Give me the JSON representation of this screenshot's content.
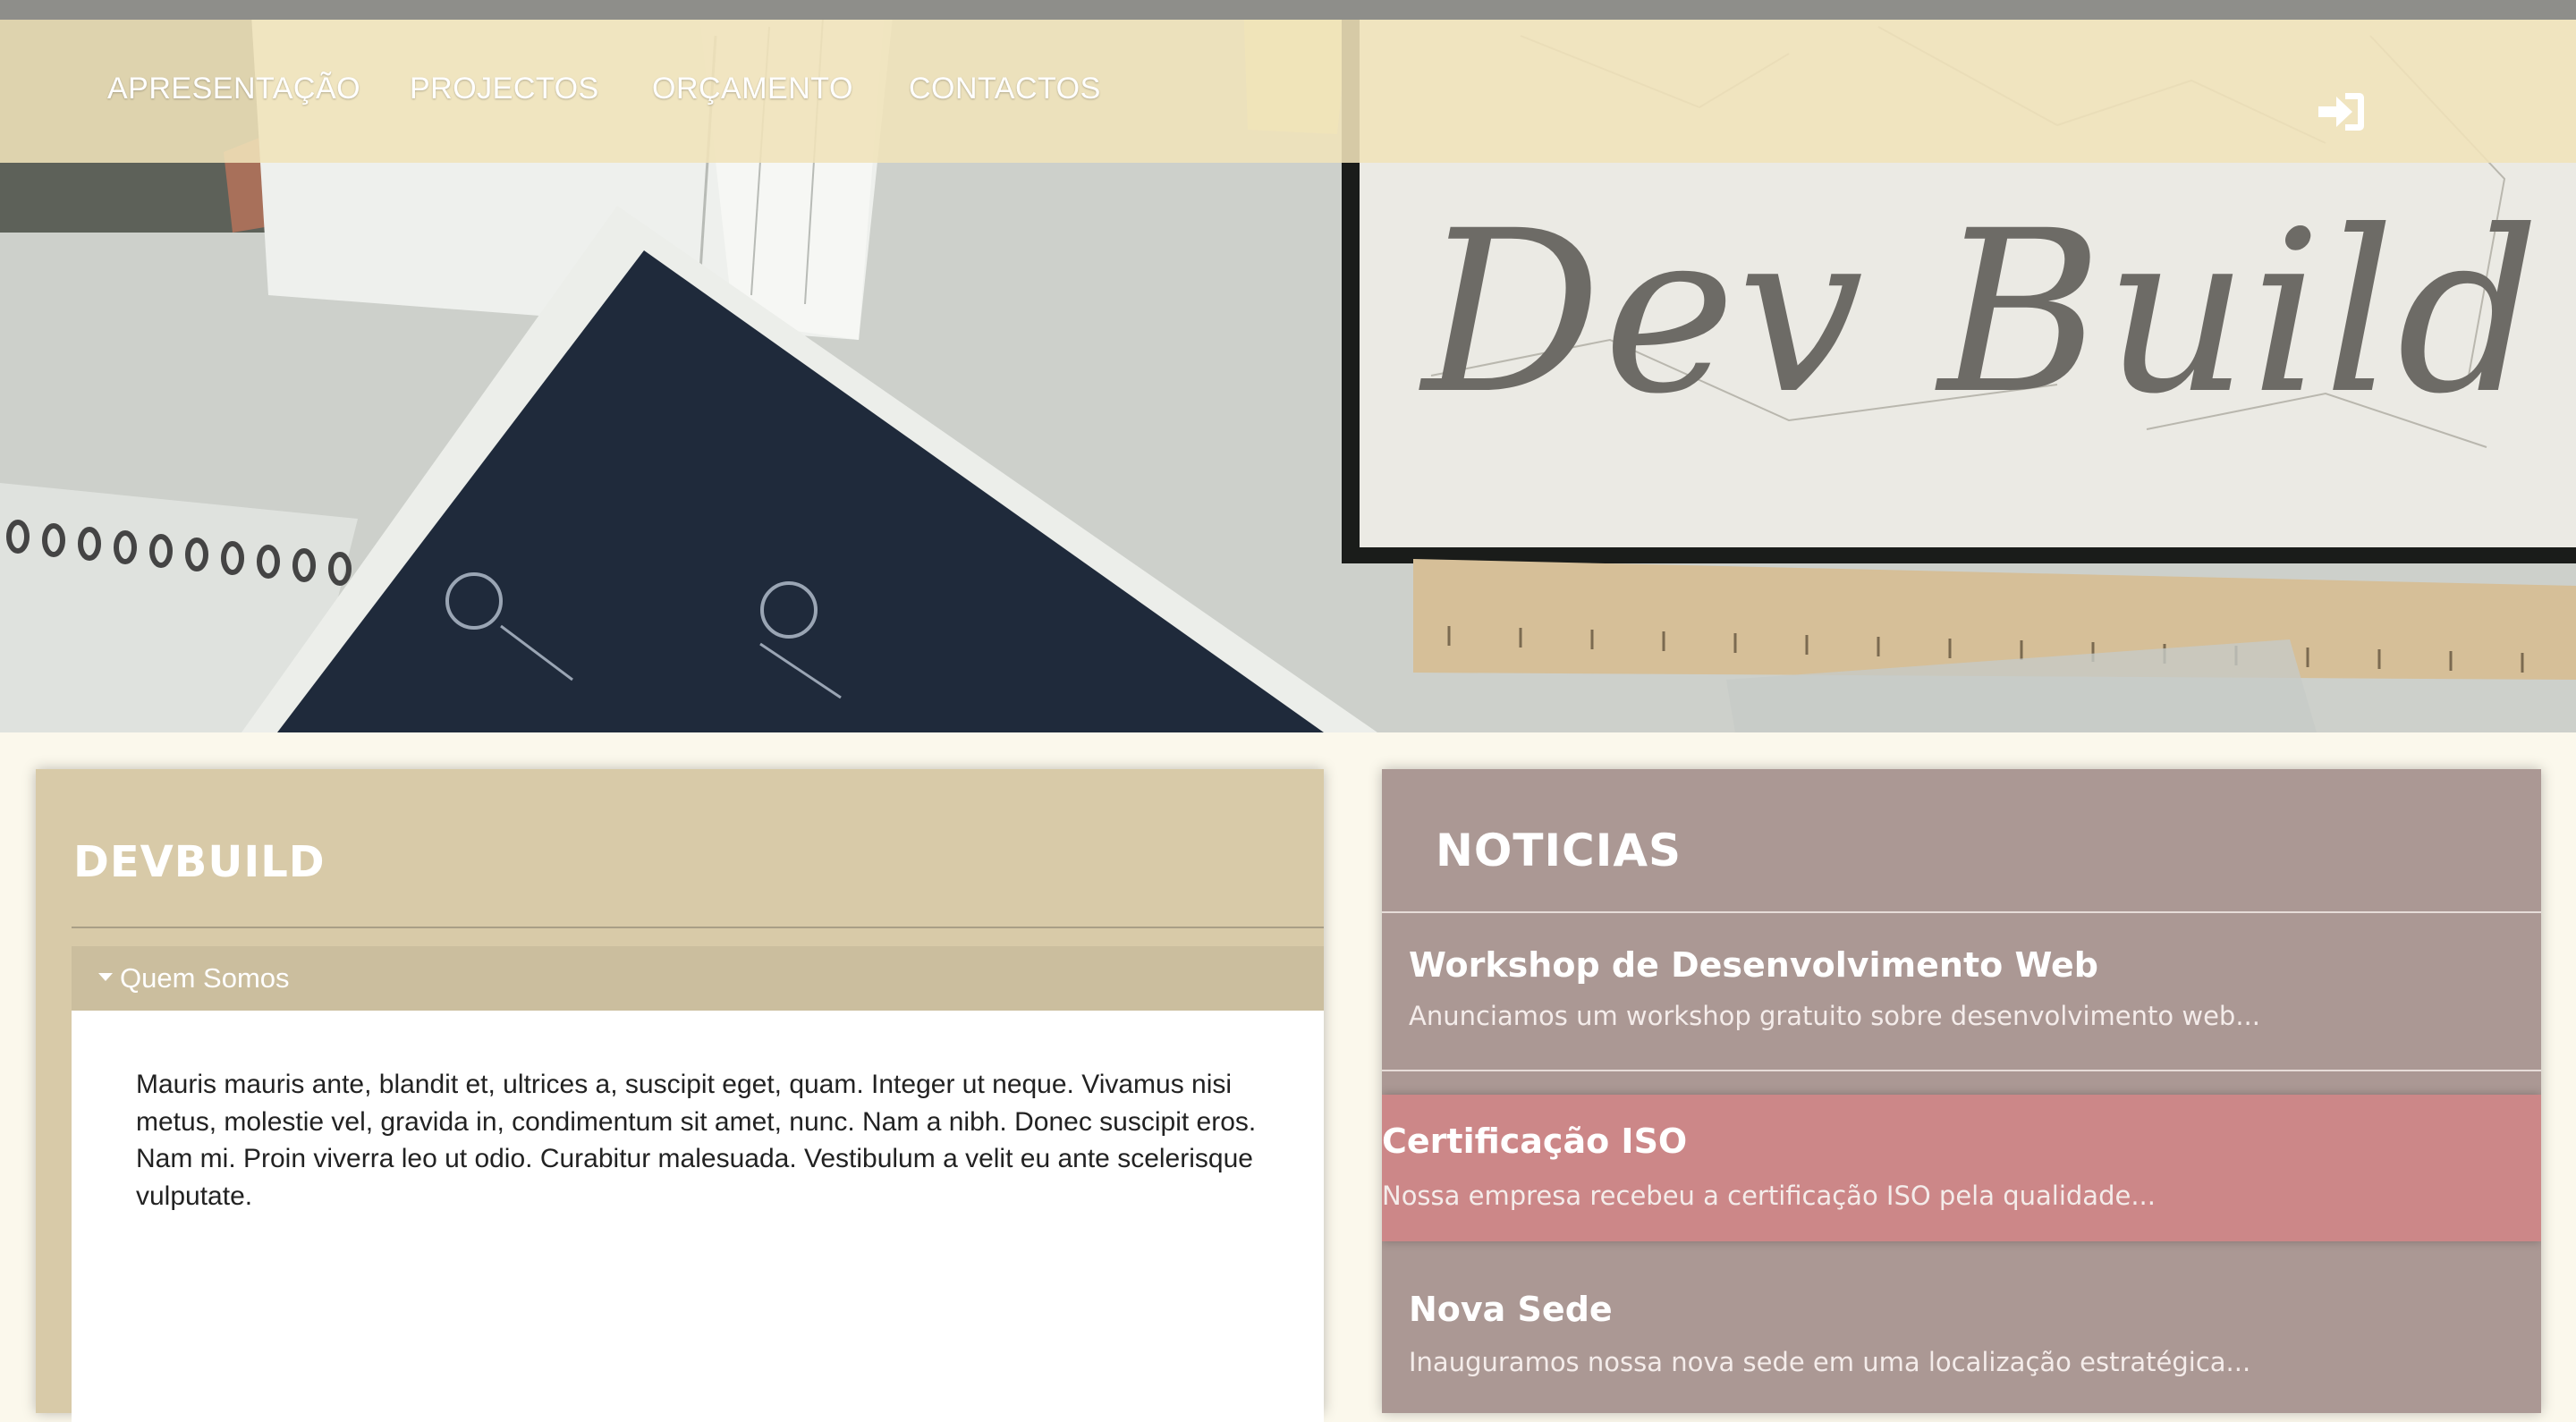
{
  "nav": {
    "items": [
      {
        "label": "APRESENTAÇÃO"
      },
      {
        "label": "PROJECTOS"
      },
      {
        "label": "ORÇAMENTO"
      },
      {
        "label": "CONTACTOS"
      }
    ],
    "login_icon": "sign-in-icon"
  },
  "hero": {
    "brand": "Dev Build"
  },
  "left_panel": {
    "title": "DEVBUILD",
    "accordion": {
      "title": "Quem Somos",
      "expanded": true,
      "body": "Mauris mauris ante, blandit et, ultrices a, suscipit eget, quam. Integer ut neque. Vivamus nisi metus, molestie vel, gravida in, condimentum sit amet, nunc. Nam a nibh. Donec suscipit eros. Nam mi. Proin viverra leo ut odio. Curabitur malesuada. Vestibulum a velit eu ante scelerisque vulputate."
    }
  },
  "right_panel": {
    "title": "NOTICIAS",
    "news": [
      {
        "title": "Workshop de Desenvolvimento Web",
        "desc": "Anunciamos um workshop gratuito sobre desenvolvimento web..."
      },
      {
        "title": "Certificação ISO",
        "desc": "Nossa empresa recebeu a certificação ISO pela qualidade..."
      },
      {
        "title": "Nova Sede",
        "desc": "Inauguramos nossa nova sede em uma localização estratégica..."
      }
    ]
  },
  "colors": {
    "page_bg": "#fbf8ec",
    "navbar": "#f0e2ba",
    "left_panel": "#d8caa8",
    "accordion_head": "#cbbe9e",
    "right_panel": "#ab9894",
    "news_highlight": "#cc8788",
    "brand_text": "#6d6b66"
  }
}
